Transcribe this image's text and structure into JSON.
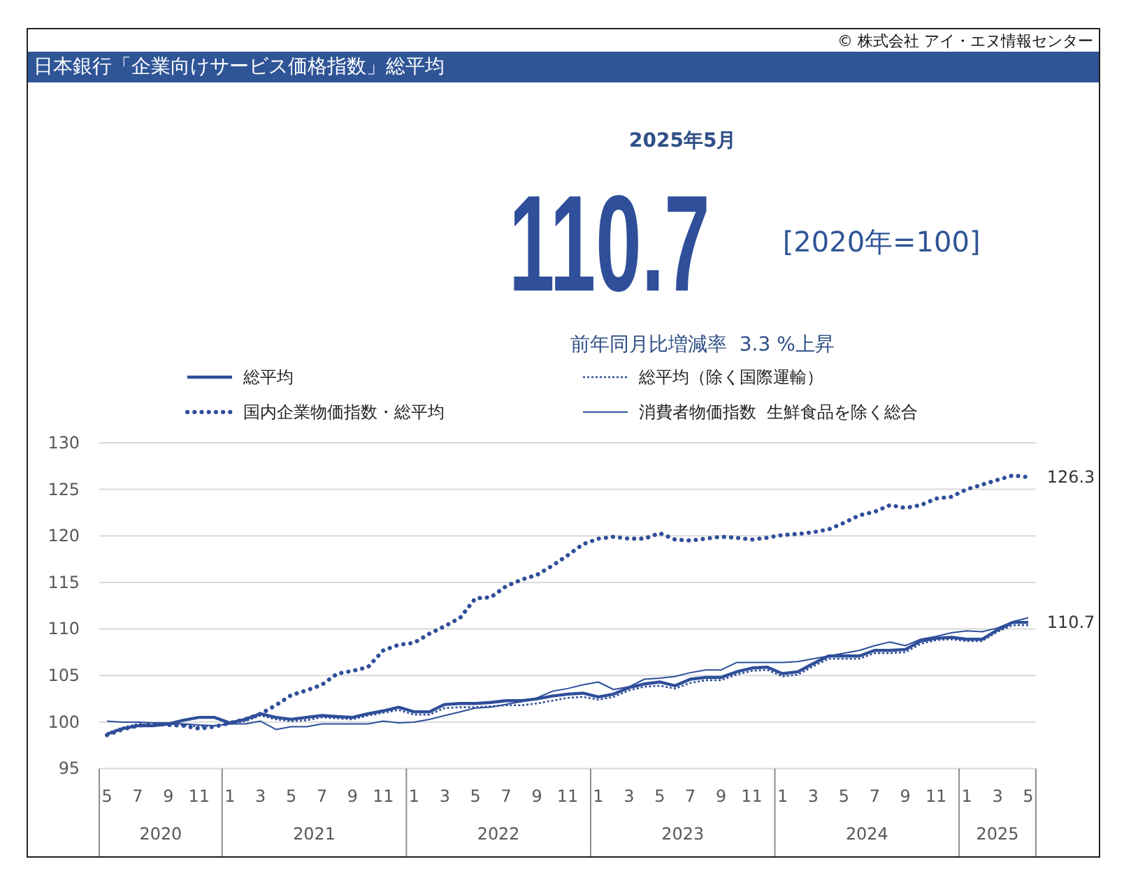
{
  "copyright": "© 株式会社 アイ・エヌ情報センター",
  "title": "日本銀行「企業向けサービス価格指数」総平均",
  "period": "2025年5月",
  "index_value": "110.7",
  "base": "[2020年=100]",
  "change": "前年同月比増減率  3.3 %上昇",
  "chart": {
    "year_groups": [
      "2020",
      "2021",
      "2022",
      "2023",
      "2024",
      "2025"
    ],
    "chart_data": {
      "type": "line",
      "grid": true,
      "ylim": [
        95,
        130
      ],
      "yticks": [
        95,
        100,
        105,
        110,
        115,
        120,
        125,
        130
      ],
      "categories": [
        "5",
        null,
        "7",
        null,
        "9",
        null,
        "11",
        null,
        "1",
        null,
        "3",
        null,
        "5",
        null,
        "7",
        null,
        "9",
        null,
        "11",
        null,
        "1",
        null,
        "3",
        null,
        "5",
        null,
        "7",
        null,
        "9",
        null,
        "11",
        null,
        "1",
        null,
        "3",
        null,
        "5",
        null,
        "7",
        null,
        "9",
        null,
        "11",
        null,
        "1",
        null,
        "3",
        null,
        "5",
        null,
        "7",
        null,
        "9",
        null,
        "11",
        null,
        "1",
        null,
        "3",
        null,
        "5"
      ],
      "series": [
        {
          "name": "総平均",
          "line_style": "solid",
          "color": "#2f4f9a",
          "values": [
            98.7,
            99.3,
            99.6,
            99.6,
            99.8,
            100.2,
            100.5,
            100.5,
            99.9,
            100.3,
            100.9,
            100.5,
            100.3,
            100.5,
            100.7,
            100.6,
            100.5,
            100.9,
            101.2,
            101.6,
            101.1,
            101.1,
            101.9,
            102.0,
            102.0,
            102.1,
            102.3,
            102.3,
            102.5,
            102.8,
            103.0,
            103.1,
            102.7,
            103.0,
            103.7,
            104.1,
            104.3,
            103.9,
            104.6,
            104.8,
            104.8,
            105.4,
            105.8,
            105.9,
            105.2,
            105.4,
            106.3,
            107.1,
            107.1,
            107.1,
            107.7,
            107.7,
            107.8,
            108.7,
            109.0,
            109.1,
            108.9,
            108.9,
            109.9,
            110.7,
            110.7
          ]
        },
        {
          "name": "総平均（除く国際運輸）",
          "line_style": "dotted",
          "color": "#2f4f9a",
          "values": [
            98.8,
            99.4,
            99.8,
            99.7,
            99.8,
            99.7,
            99.5,
            99.6,
            99.8,
            100.1,
            100.7,
            100.3,
            100.1,
            100.2,
            100.5,
            100.4,
            100.3,
            100.7,
            101.0,
            101.3,
            100.8,
            100.8,
            101.5,
            101.6,
            101.6,
            101.7,
            101.8,
            101.8,
            102.0,
            102.3,
            102.6,
            102.7,
            102.4,
            102.7,
            103.4,
            103.8,
            103.9,
            103.6,
            104.2,
            104.5,
            104.5,
            105.1,
            105.5,
            105.6,
            104.9,
            105.1,
            106.0,
            106.8,
            106.8,
            106.8,
            107.4,
            107.4,
            107.5,
            108.4,
            108.8,
            108.9,
            108.7,
            108.7,
            109.7,
            110.4,
            110.4
          ]
        },
        {
          "name": "国内企業物価指数・総平均",
          "line_style": "dotted",
          "color": "#2f4f9a",
          "values": [
            98.6,
            99.2,
            99.6,
            99.8,
            99.7,
            99.6,
            99.3,
            99.5,
            99.9,
            100.3,
            100.9,
            101.8,
            102.9,
            103.4,
            104.0,
            105.2,
            105.5,
            105.9,
            107.7,
            108.3,
            108.5,
            109.5,
            110.3,
            111.2,
            113.3,
            113.4,
            114.6,
            115.3,
            115.8,
            116.8,
            117.9,
            119.1,
            119.7,
            119.9,
            119.7,
            119.7,
            120.3,
            119.6,
            119.5,
            119.7,
            119.9,
            119.8,
            119.6,
            119.8,
            120.1,
            120.2,
            120.4,
            120.7,
            121.4,
            122.2,
            122.6,
            123.3,
            123.0,
            123.3,
            124.0,
            124.2,
            125.0,
            125.5,
            126.0,
            126.5,
            126.3
          ]
        },
        {
          "name": "消費者物価指数  生鮮食品を除く総合",
          "line_style": "solid",
          "color": "#2f4f9a",
          "values": [
            100.1,
            100.0,
            100.0,
            99.9,
            99.9,
            99.8,
            99.7,
            99.6,
            99.8,
            99.8,
            100.1,
            99.2,
            99.5,
            99.5,
            99.8,
            99.8,
            99.8,
            99.8,
            100.1,
            99.9,
            100.0,
            100.3,
            100.7,
            101.1,
            101.5,
            101.6,
            101.9,
            102.2,
            102.6,
            103.3,
            103.6,
            104.0,
            104.3,
            103.5,
            103.8,
            104.6,
            104.7,
            104.9,
            105.3,
            105.6,
            105.6,
            106.4,
            106.4,
            106.4,
            106.4,
            106.5,
            106.8,
            107.1,
            107.4,
            107.7,
            108.2,
            108.6,
            108.2,
            108.9,
            109.2,
            109.6,
            109.8,
            109.7,
            110.1,
            110.8,
            111.2
          ]
        }
      ],
      "annotations": [
        "126.3",
        "110.7"
      ]
    }
  }
}
